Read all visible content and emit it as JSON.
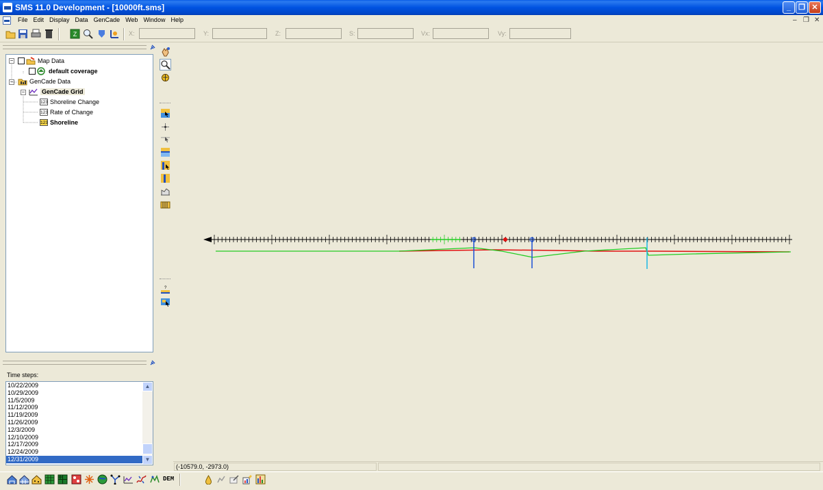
{
  "window": {
    "title": "SMS 11.0 Development - [10000ft.sms]",
    "minimize_glyph": "_",
    "restore_glyph": "❐",
    "close_glyph": "✕"
  },
  "menu": {
    "items": [
      "File",
      "Edit",
      "Display",
      "Data",
      "GenCade",
      "Web",
      "Window",
      "Help"
    ],
    "mdi_minimize": "–",
    "mdi_restore": "❐",
    "mdi_close": "✕"
  },
  "toolbar": {
    "coord_labels": [
      "X:",
      "Y:",
      "Z:",
      "S:",
      "Vx:",
      "Vy:"
    ],
    "coord_values": [
      "",
      "",
      "",
      "",
      "",
      ""
    ]
  },
  "tree": {
    "items": [
      {
        "label": "Map Data",
        "bold": false
      },
      {
        "label": "default coverage",
        "bold": true
      },
      {
        "label": "GenCade Data",
        "bold": false
      },
      {
        "label": "GenCade Grid",
        "bold": true
      },
      {
        "label": "Shoreline Change",
        "bold": false,
        "icon_text": "123"
      },
      {
        "label": "Rate of Change",
        "bold": false,
        "icon_text": "123"
      },
      {
        "label": "Shoreline",
        "bold": true,
        "icon_text": "123"
      }
    ]
  },
  "timesteps": {
    "label": "Time steps:",
    "items": [
      "10/22/2009",
      "10/29/2009",
      "11/5/2009",
      "11/12/2009",
      "11/19/2009",
      "11/26/2009",
      "12/3/2009",
      "12/10/2009",
      "12/17/2009",
      "12/24/2009",
      "12/31/2009"
    ],
    "selected_index": 10,
    "scroll_up": "▲",
    "scroll_down": "▼"
  },
  "status": {
    "coords": "(-10579.0, -2973.0)"
  },
  "bottombar": {
    "dem_label": "DEM"
  },
  "colors": {
    "grid_line": "#000000",
    "shoreline_green": "#22cc22",
    "shoreline_red": "#e01010",
    "structure_blue": "#1a4fd6",
    "structure_cyan": "#1ab7e6"
  },
  "icons": {
    "toolbar": [
      "open-icon",
      "save-icon",
      "print-icon",
      "delete-icon",
      "refresh-icon",
      "zoom-icon",
      "frame-icon",
      "rotate-icon"
    ],
    "vertical_tools": [
      "pan-icon",
      "zoom-tool-icon",
      "rotate-tool-icon",
      "select-cell-icon",
      "create-node-icon",
      "select-node-icon",
      "select-row-icon",
      "select-structure-icon",
      "create-structure-icon",
      "grid-frame-icon",
      "grid-icon",
      "query-icon",
      "select-info-icon"
    ],
    "bottom": [
      "mesh-module-icon",
      "grid-module-icon",
      "scatter-module-icon",
      "cartesian-grid-icon",
      "quadtree-icon",
      "raster-icon",
      "particle-icon",
      "globe-icon",
      "network-icon",
      "gencade-module-icon",
      "shoreline-module-icon",
      "map-module-icon",
      "dem-icon",
      "hydrograph-icon",
      "profile-icon",
      "annotation-icon",
      "plot-icon",
      "chart-icon"
    ]
  }
}
